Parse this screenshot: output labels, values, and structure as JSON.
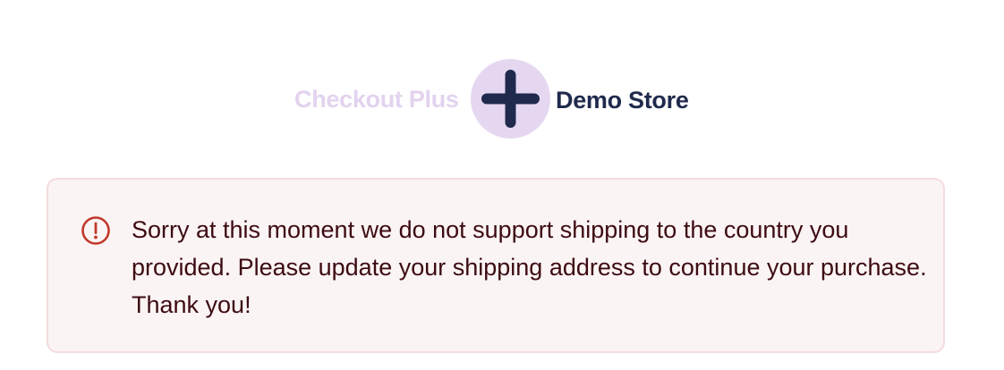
{
  "logo": {
    "left_text": "Checkout Plus",
    "right_text": "Demo Store",
    "icon": "plus-icon"
  },
  "alert": {
    "icon": "alert-circle-icon",
    "message": "Sorry at this moment we do not support shipping to the country you provided. Please update your shipping address to continue your purchase. Thank you!"
  },
  "colors": {
    "brand_light": "#e3d3ef",
    "brand_circle": "#e6d7f1",
    "brand_dark": "#1f2a4d",
    "alert_bg": "#fbf4f4",
    "alert_border": "#f4dcdd",
    "alert_icon": "#c0392b",
    "alert_text": "#3d0b12"
  }
}
